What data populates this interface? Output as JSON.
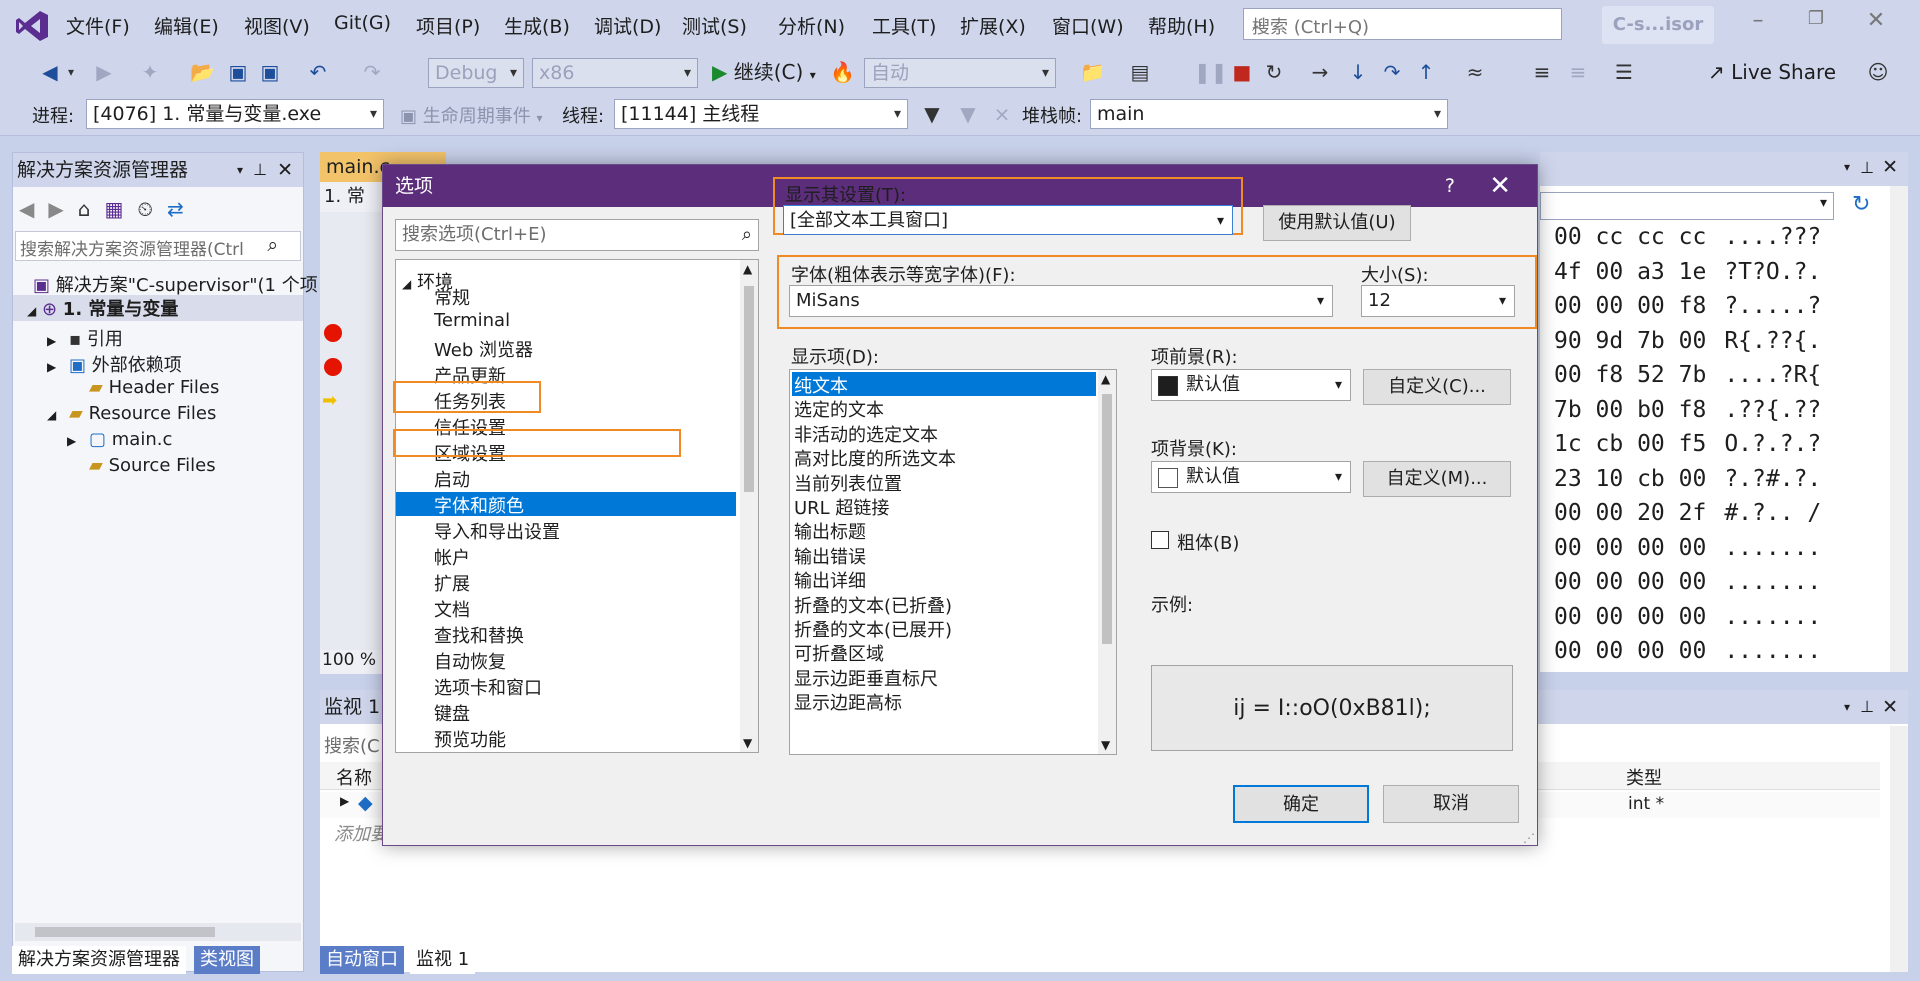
{
  "menu": {
    "items": [
      "文件(F)",
      "编辑(E)",
      "视图(V)",
      "Git(G)",
      "项目(P)",
      "生成(B)",
      "调试(D)",
      "测试(S)",
      "分析(N)",
      "工具(T)",
      "扩展(X)",
      "窗口(W)",
      "帮助(H)"
    ],
    "search_placeholder": "搜索 (Ctrl+Q)",
    "title": "C-s...isor"
  },
  "toolbar": {
    "config": "Debug",
    "platform": "x86",
    "continue": "继续(C)",
    "auto": "自动",
    "live_share": "Live Share",
    "process_label": "进程:",
    "process_value": "[4076] 1. 常量与变量.exe",
    "lifecycle": "生命周期事件",
    "thread_label": "线程:",
    "thread_value": "[11144] 主线程",
    "stack_label": "堆栈帧:",
    "stack_value": "main"
  },
  "solution_explorer": {
    "title": "解决方案资源管理器",
    "search_placeholder": "搜索解决方案资源管理器(Ctrl",
    "solution": "解决方案\"C-supervisor\"(1 个项",
    "project": "1. 常量与变量",
    "items": [
      "引用",
      "外部依赖项",
      "Header Files",
      "Resource Files",
      "main.c",
      "Source Files"
    ]
  },
  "editor": {
    "tab": "main.c",
    "zoom": "100 %",
    "breadcrumb": "1. 常"
  },
  "memory": {
    "lines": [
      {
        "hex": "00 cc cc cc",
        "asc": "....???"
      },
      {
        "hex": "4f 00 a3 1e",
        "asc": "?T?O.?."
      },
      {
        "hex": "00 00 00 f8",
        "asc": "?.....?"
      },
      {
        "hex": "90 9d 7b 00",
        "asc": "R{.??{."
      },
      {
        "hex": "00 f8 52 7b",
        "asc": "....?R{"
      },
      {
        "hex": "7b 00 b0 f8",
        "asc": ".??{.??"
      },
      {
        "hex": "1c cb 00 f5",
        "asc": "O.?.?.?"
      },
      {
        "hex": "23 10 cb 00",
        "asc": "?.?#.?."
      },
      {
        "hex": "00 00 20 2f",
        "asc": "#.?.. /"
      },
      {
        "hex": "00 00 00 00",
        "asc": "......."
      },
      {
        "hex": "00 00 00 00",
        "asc": "......."
      },
      {
        "hex": "00 00 00 00",
        "asc": "......."
      },
      {
        "hex": "00 00 00 00",
        "asc": "......."
      }
    ]
  },
  "watch": {
    "title": "监视 1",
    "search": "搜索(C",
    "col_name": "名称",
    "col_type": "类型",
    "row_type": "int *",
    "add": "添加要"
  },
  "bottom_tabs": [
    "解决方案资源管理器",
    "类视图",
    "自动窗口",
    "监视 1"
  ],
  "dialog": {
    "title": "选项",
    "help": "?",
    "search_placeholder": "搜索选项(Ctrl+E)",
    "tree_root": "环境",
    "tree_items": [
      "常规",
      "Terminal",
      "Web 浏览器",
      "产品更新",
      "任务列表",
      "信任设置",
      "区域设置",
      "启动",
      "字体和颜色",
      "导入和导出设置",
      "帐户",
      "扩展",
      "文档",
      "查找和替换",
      "自动恢复",
      "选项卡和窗口",
      "键盘",
      "预览功能"
    ],
    "tree_selected_index": 8,
    "show_settings_label": "显示其设置(T):",
    "show_settings_value": "[全部文本工具窗口]",
    "use_defaults": "使用默认值(U)",
    "font_label": "字体(粗体表示等宽字体)(F):",
    "font_value": "MiSans",
    "size_label": "大小(S):",
    "size_value": "12",
    "display_items_label": "显示项(D):",
    "display_items": [
      "纯文本",
      "选定的文本",
      "非活动的选定文本",
      "高对比度的所选文本",
      "当前列表位置",
      "URL 超链接",
      "输出标题",
      "输出错误",
      "输出详细",
      "折叠的文本(已折叠)",
      "折叠的文本(已展开)",
      "可折叠区域",
      "显示边距垂直标尺",
      "显示边距高标"
    ],
    "display_selected_index": 0,
    "fg_label": "项前景(R):",
    "fg_value": "默认值",
    "fg_custom": "自定义(C)...",
    "bg_label": "项背景(K):",
    "bg_value": "默认值",
    "bg_custom": "自定义(M)...",
    "bold_label": "粗体(B)",
    "sample_label": "示例:",
    "sample_text": "ij = I::oO(0xB81l);",
    "ok": "确定",
    "cancel": "取消"
  },
  "colors": {
    "accent": "#0078d7",
    "title_bar": "#5b2d7b",
    "highlight": "#f08a24",
    "breakpoint": "#e51400"
  }
}
